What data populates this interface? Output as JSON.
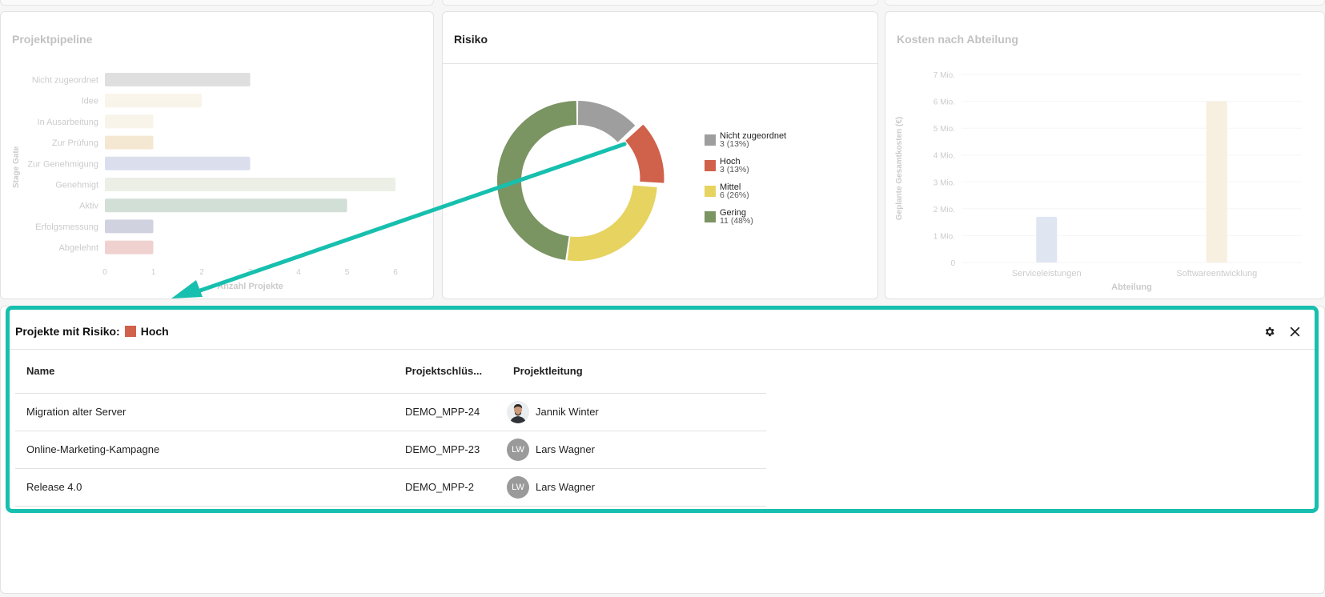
{
  "pipeline": {
    "title": "Projektpipeline",
    "chart_data": {
      "type": "bar",
      "orientation": "horizontal",
      "categories": [
        "Nicht zugeordnet",
        "Idee",
        "In Ausarbeitung",
        "Zur Prüfung",
        "Zur Genehmigung",
        "Genehmigt",
        "Aktiv",
        "Erfolgsmessung",
        "Abgelehnt"
      ],
      "values": [
        3,
        2,
        1,
        1,
        3,
        6,
        5,
        1,
        1
      ],
      "colors": [
        "#8c8c8c",
        "#ead9b4",
        "#ead9b4",
        "#d9b063",
        "#7f8fbf",
        "#b8c7a5",
        "#5f8f6f",
        "#5a5f8f",
        "#c9605a"
      ],
      "xlabel": "Anzahl Projekte",
      "ylabel": "Stage Gate",
      "xticks": [
        "0",
        "1",
        "2",
        "3",
        "4",
        "5",
        "6"
      ],
      "xlim": [
        0,
        6
      ]
    }
  },
  "risk": {
    "title": "Risiko",
    "chart_data": {
      "type": "pie",
      "donut": true,
      "labels": [
        "Nicht zugeordnet",
        "Hoch",
        "Mittel",
        "Gering"
      ],
      "values": [
        3,
        3,
        6,
        11
      ],
      "value_labels": [
        "3 (13%)",
        "3 (13%)",
        "6 (26%)",
        "11 (48%)"
      ],
      "colors": [
        "#9e9e9e",
        "#d0614a",
        "#e6d360",
        "#7a9462"
      ],
      "exploded": "Hoch",
      "legend": "right"
    }
  },
  "costs": {
    "title": "Kosten nach Abteilung",
    "chart_data": {
      "type": "bar",
      "categories": [
        "Serviceleistungen",
        "Softwareentwicklung"
      ],
      "values": [
        1.7,
        6
      ],
      "colors": [
        "#8fa3cf",
        "#e3c98f"
      ],
      "xlabel": "Abteilung",
      "ylabel": "Geplante Gesamtkosten (€)",
      "yticks": [
        "0",
        "1 Mio.",
        "2 Mio.",
        "3 Mio.",
        "4 Mio.",
        "5 Mio.",
        "6 Mio.",
        "7 Mio."
      ],
      "ylim": [
        0,
        7
      ]
    }
  },
  "panel": {
    "title_prefix": "Projekte mit Risiko:",
    "risk_label": "Hoch",
    "risk_color": "#d0614a",
    "settings_icon": "gear-icon",
    "close_icon": "close-icon",
    "columns": [
      "Name",
      "Projektschlüs...",
      "Projektleitung"
    ],
    "rows": [
      {
        "name": "Migration alter Server",
        "key": "DEMO_MPP-24",
        "lead": "Jannik Winter",
        "avatar": "photo"
      },
      {
        "name": "Online-Marketing-Kampagne",
        "key": "DEMO_MPP-23",
        "lead": "Lars Wagner",
        "initials": "LW"
      },
      {
        "name": "Release 4.0",
        "key": "DEMO_MPP-2",
        "lead": "Lars Wagner",
        "initials": "LW"
      }
    ]
  },
  "accent_color": "#17bfae"
}
